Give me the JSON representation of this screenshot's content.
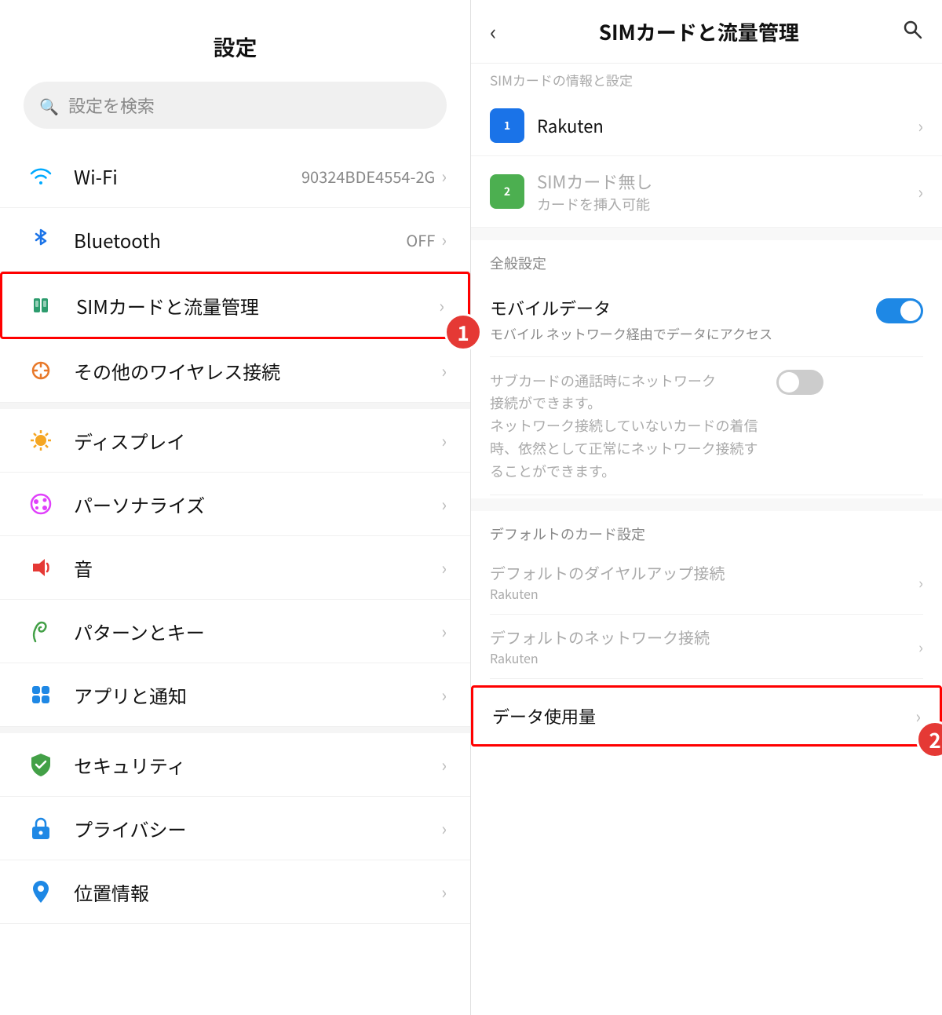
{
  "leftPanel": {
    "title": "設定",
    "searchPlaceholder": "設定を検索",
    "items": [
      {
        "id": "wifi",
        "label": "Wi-Fi",
        "value": "90324BDE4554-2G",
        "iconType": "wifi",
        "iconSymbol": "📶"
      },
      {
        "id": "bluetooth",
        "label": "Bluetooth",
        "value": "OFF",
        "iconType": "bt",
        "iconSymbol": "✦"
      },
      {
        "id": "sim",
        "label": "SIMカードと流量管理",
        "value": "",
        "iconType": "sim",
        "iconSymbol": "↕",
        "highlighted": true,
        "stepBadge": "1"
      },
      {
        "id": "wireless",
        "label": "その他のワイヤレス接続",
        "value": "",
        "iconType": "wireless",
        "iconSymbol": "◎"
      }
    ],
    "items2": [
      {
        "id": "display",
        "label": "ディスプレイ",
        "iconSymbol": "☀"
      },
      {
        "id": "personalize",
        "label": "パーソナライズ",
        "iconSymbol": "🎨"
      },
      {
        "id": "sound",
        "label": "音",
        "iconSymbol": "🔊"
      },
      {
        "id": "pattern",
        "label": "パターンとキー",
        "iconSymbol": "✋"
      },
      {
        "id": "app",
        "label": "アプリと通知",
        "iconSymbol": "📱"
      }
    ],
    "items3": [
      {
        "id": "security",
        "label": "セキュリティ",
        "iconSymbol": "🛡"
      },
      {
        "id": "privacy",
        "label": "プライバシー",
        "iconSymbol": "🔒"
      },
      {
        "id": "location",
        "label": "位置情報",
        "iconSymbol": "📍"
      }
    ]
  },
  "rightPanel": {
    "title": "SIMカードと流量管理",
    "backLabel": "‹",
    "searchLabel": "🔍",
    "scrolledSectionLabel": "SIMカードの情報と設定",
    "simCards": [
      {
        "id": "sim1",
        "name": "Rakuten",
        "simClass": "sim1",
        "simNumber": "1",
        "sub": ""
      },
      {
        "id": "sim2",
        "name": "SIMカード無し",
        "sub": "カードを挿入可能",
        "simClass": "sim2",
        "simNumber": "2"
      }
    ],
    "generalSettingsLabel": "全般設定",
    "mobileData": {
      "title": "モバイルデータ",
      "desc": "モバイル ネットワーク経由でデータにアクセス",
      "toggleOn": true
    },
    "subCardRow": {
      "line1": "サブカードの通話時にネットワーク",
      "line2": "接続ができます。",
      "line3": "ネットワーク接続していないカードの着信",
      "line4": "時、依然として正常にネットワーク接続す",
      "line5": "ることができます。",
      "toggleOn": false
    },
    "defaultCardSettingsLabel": "デフォルトのカード設定",
    "defaultCardItems": [
      {
        "id": "dialup",
        "main": "デフォルトのダイヤルアップ接続",
        "sub": "Rakuten",
        "grayed": true
      },
      {
        "id": "network",
        "main": "デフォルトのネットワーク接続",
        "sub": "Rakuten",
        "grayed": true
      }
    ],
    "dataUsageLabel": "データ使用量",
    "stepBadge2": "2"
  }
}
